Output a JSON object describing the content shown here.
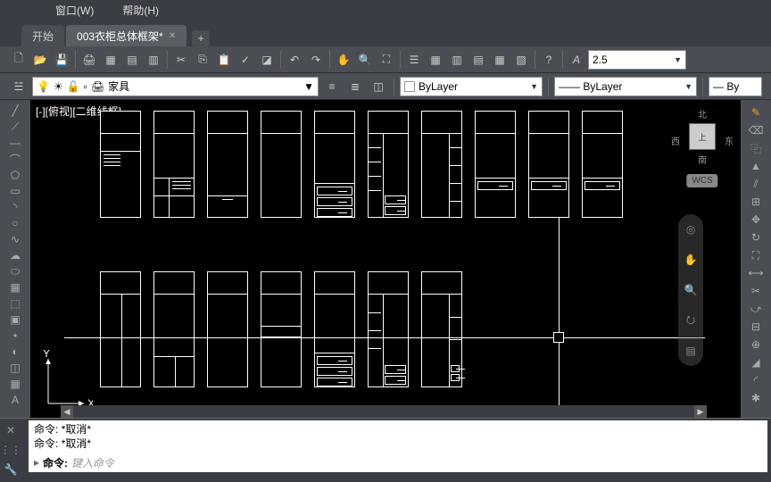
{
  "menu": {
    "window": "窗口(W)",
    "help": "帮助(H)"
  },
  "tabs": {
    "start": "开始",
    "doc": "003衣柜总体框架*",
    "close": "✕",
    "add": "+"
  },
  "lineweight": "2.5",
  "layer": {
    "name": "家具",
    "bylayer1": "ByLayer",
    "bylayer2": "ByLayer",
    "bylayer3": "By"
  },
  "viewport_label": "[-][俯视][二维线框]",
  "axis": {
    "x": "X",
    "y": "Y"
  },
  "viewcube": {
    "n": "北",
    "s": "南",
    "e": "东",
    "w": "西",
    "top": "上",
    "wcs": "WCS"
  },
  "cmd": {
    "hist1": "命令: *取消*",
    "hist2": "命令: *取消*",
    "prompt": "命令:",
    "placeholder": "键入命令"
  }
}
